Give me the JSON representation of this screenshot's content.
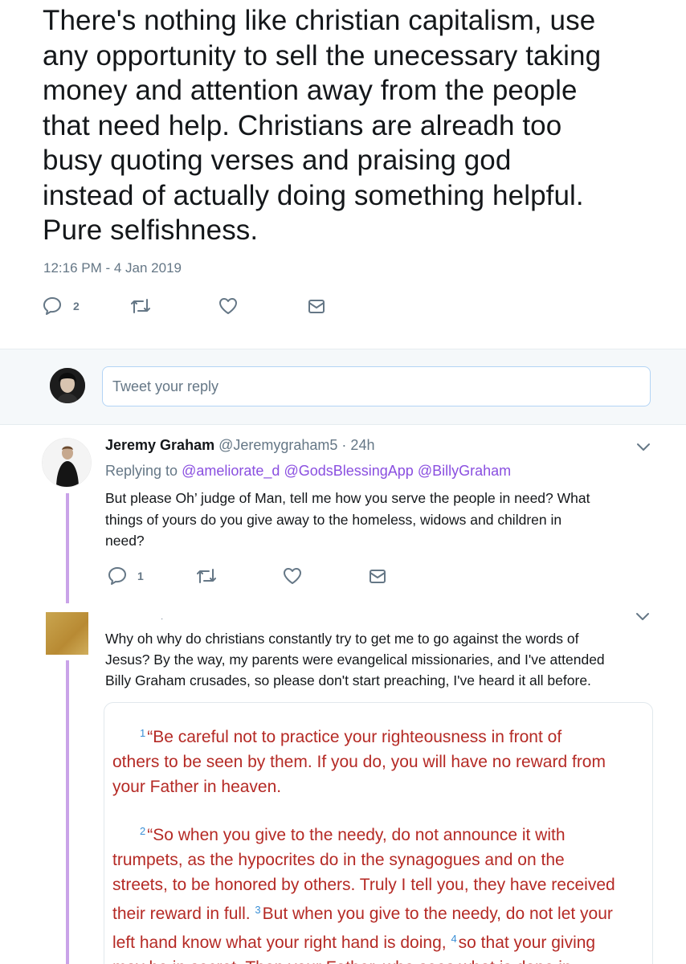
{
  "main_tweet": {
    "lines": [
      "There's nothing like christian capitalism, use",
      "any opportunity to sell the unecessary taking",
      "money and attention away from the people",
      "that need help. Christians are alreadh too",
      "busy quoting verses and praising god",
      "instead of actually doing something helpful.",
      "Pure selfishness."
    ],
    "timestamp": "12:16 PM - 4 Jan 2019",
    "reply_count": "2"
  },
  "reply_box": {
    "placeholder": "Tweet your reply"
  },
  "reply1": {
    "name": "Jeremy Graham",
    "handle_time": "@Jeremygraham5 · 24h",
    "replying_label": "Replying to",
    "mentions": [
      "@ameliorate_d",
      "@GodsBlessingApp",
      "@BillyGraham"
    ],
    "lines": [
      "But please Oh’ judge of Man, tell me how you serve the people in need? What",
      "things of yours do you give away to the homeless, widows and children in",
      "need?"
    ],
    "reply_count": "1"
  },
  "reply2": {
    "marker": "·",
    "lines": [
      "Why oh why do christians constantly try to get me to go against the words of",
      "Jesus? By the way, my parents were evangelical missionaries, and I've attended",
      "Billy Graham crusades, so please don't start preaching, I've heard it all before."
    ],
    "scripture": {
      "v1": "1",
      "p1_lines": [
        "“Be careful not to practice your righteousness in front of",
        "others to be seen by them. If you do, you will have no reward from",
        "your Father in heaven."
      ],
      "v2": "2",
      "p2_lines": [
        "“So when you give to the needy, do not announce it with",
        "trumpets, as the hypocrites do in the synagogues and on the",
        "streets, to be honored by others. Truly I tell you, they have received"
      ],
      "p2_l4a": "their reward in full.",
      "v3": "3",
      "p2_l4b": "But when you give to the needy, do not let your",
      "p2_l5a": "left hand know what your right hand is doing,",
      "v4": "4",
      "p2_l5b": "so that your giving",
      "p2_l6": "may be in secret. Then your Father, who sees what is done in"
    }
  },
  "colors": {
    "thread_line": "#c9a3e8",
    "mention": "#8a4fe0",
    "scripture_text": "#b52a25",
    "verse_number": "#3a8fd6",
    "icon_gray": "#657786"
  }
}
